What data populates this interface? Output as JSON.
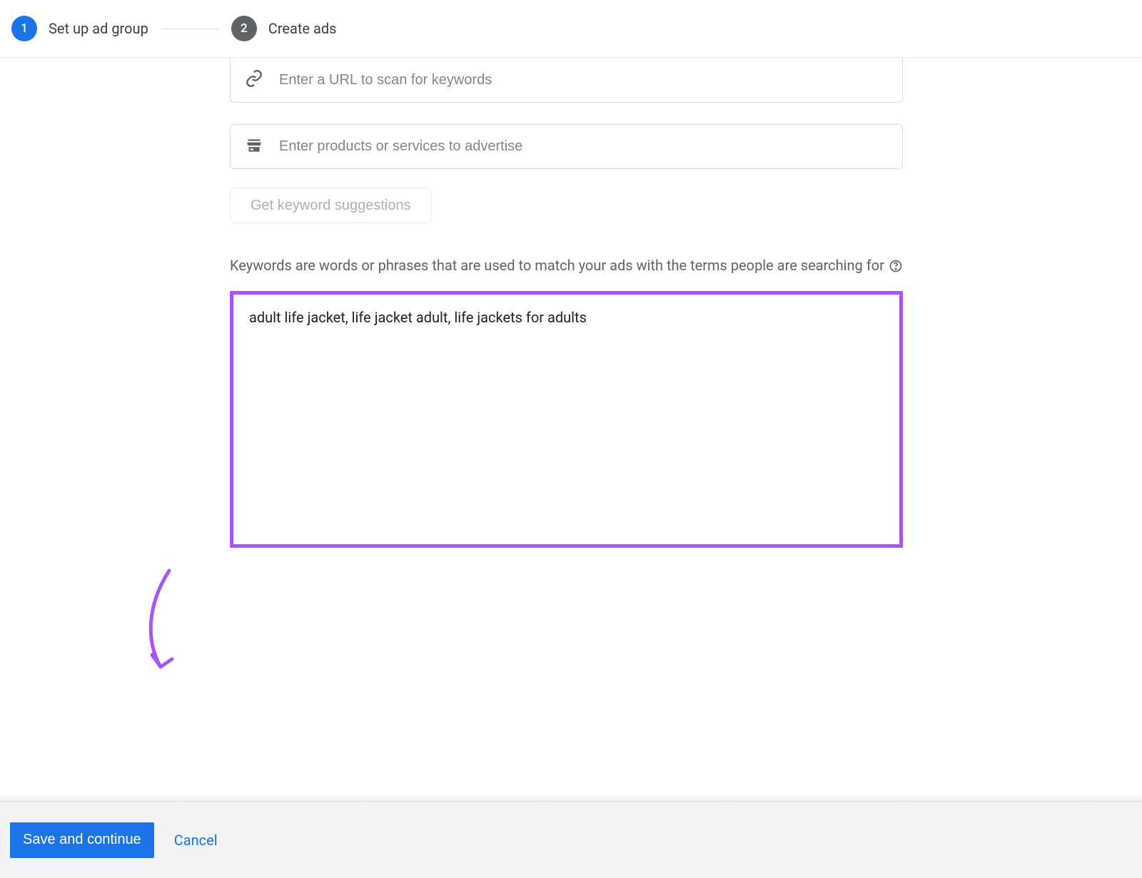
{
  "stepper": {
    "steps": [
      {
        "num": "1",
        "label": "Set up ad group",
        "state": "active"
      },
      {
        "num": "2",
        "label": "Create ads",
        "state": "inactive"
      }
    ]
  },
  "inputs": {
    "url_placeholder": "Enter a URL to scan for keywords",
    "products_placeholder": "Enter products or services to advertise"
  },
  "buttons": {
    "suggest": "Get keyword suggestions",
    "save": "Save and continue",
    "cancel": "Cancel"
  },
  "helper": {
    "text": "Keywords are words or phrases that are used to match your ads with the terms people are searching for"
  },
  "keywords": {
    "value": "adult life jacket, life jacket adult, life jackets for adults"
  },
  "colors": {
    "accent": "#1a73e8",
    "highlight": "#a855f7"
  }
}
